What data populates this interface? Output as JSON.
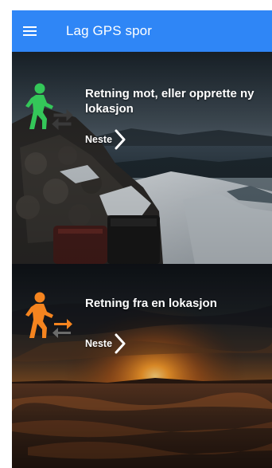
{
  "appbar": {
    "title": "Lag GPS spor",
    "menu_icon": "hamburger-menu-icon",
    "color": "#2f86f6"
  },
  "cards": [
    {
      "title": "Retning mot, eller opprette ny lokasjon",
      "next_label": "Neste",
      "icon": "person-walking-with-arrows-icon",
      "icon_color": "#34c759",
      "background": "mountain-cairn-snow-photo"
    },
    {
      "title": "Retning fra en lokasjon",
      "next_label": "Neste",
      "icon": "person-walking-with-arrows-icon",
      "icon_color": "#f5841f",
      "background": "sunset-over-sand-photo"
    }
  ]
}
